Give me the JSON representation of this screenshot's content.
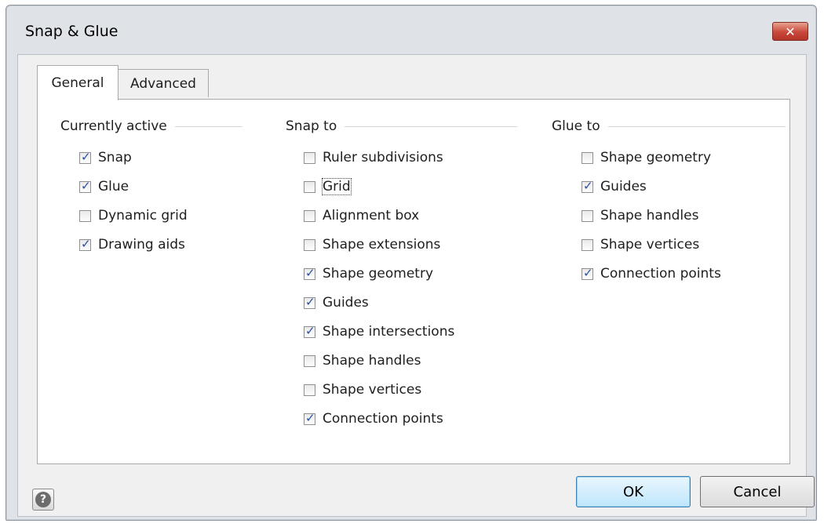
{
  "window": {
    "title": "Snap & Glue",
    "close_label": "✕"
  },
  "tabs": [
    {
      "label": "General",
      "active": true
    },
    {
      "label": "Advanced",
      "active": false
    }
  ],
  "groups": {
    "currently_active": {
      "header": "Currently active",
      "items": [
        {
          "label": "Snap",
          "checked": true
        },
        {
          "label": "Glue",
          "checked": true
        },
        {
          "label": "Dynamic grid",
          "checked": false
        },
        {
          "label": "Drawing aids",
          "checked": true
        }
      ]
    },
    "snap_to": {
      "header": "Snap to",
      "items": [
        {
          "label": "Ruler subdivisions",
          "checked": false
        },
        {
          "label": "Grid",
          "checked": false,
          "focused": true
        },
        {
          "label": "Alignment box",
          "checked": false
        },
        {
          "label": "Shape extensions",
          "checked": false
        },
        {
          "label": "Shape geometry",
          "checked": true
        },
        {
          "label": "Guides",
          "checked": true
        },
        {
          "label": "Shape intersections",
          "checked": true
        },
        {
          "label": "Shape handles",
          "checked": false
        },
        {
          "label": "Shape vertices",
          "checked": false
        },
        {
          "label": "Connection points",
          "checked": true
        }
      ]
    },
    "glue_to": {
      "header": "Glue to",
      "items": [
        {
          "label": "Shape geometry",
          "checked": false
        },
        {
          "label": "Guides",
          "checked": true
        },
        {
          "label": "Shape handles",
          "checked": false
        },
        {
          "label": "Shape vertices",
          "checked": false
        },
        {
          "label": "Connection points",
          "checked": true
        }
      ]
    }
  },
  "footer": {
    "help_icon": "question-mark-icon",
    "help_label": "?",
    "ok_label": "OK",
    "cancel_label": "Cancel"
  }
}
